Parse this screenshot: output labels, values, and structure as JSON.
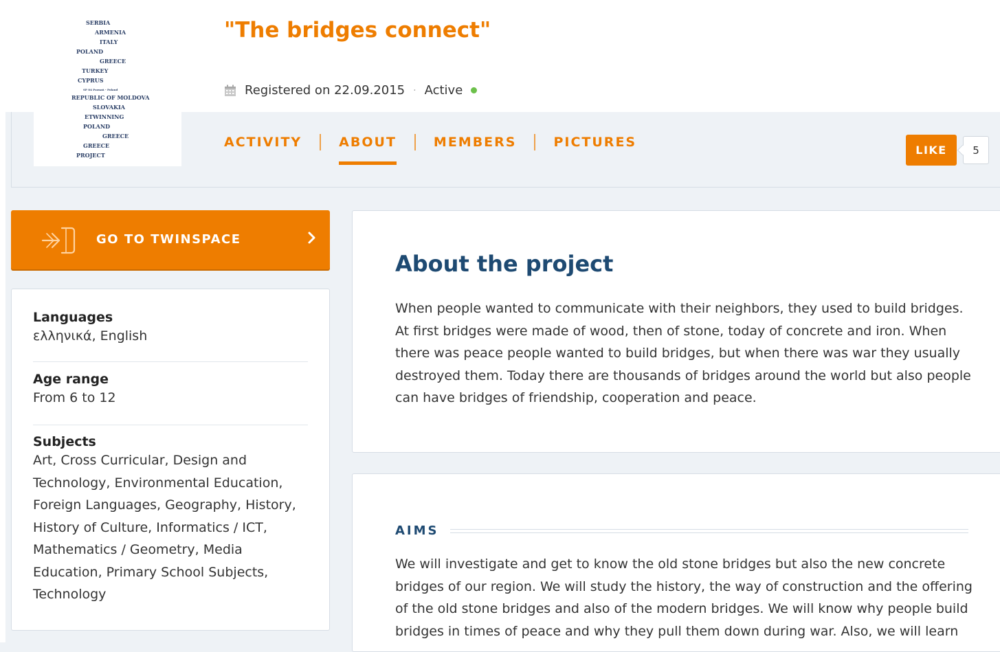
{
  "logo": {
    "words": [
      "SERBIA",
      "ARMENIA",
      "ITALY",
      "POLAND",
      "GREECE",
      "TURKEY",
      "CYPRUS",
      "SP 84 Poznań - Poland",
      "REPUBLIC OF MOLDOVA",
      "SLOVAKIA",
      "ETWINNING",
      "POLAND",
      "GREECE",
      "GREECE",
      "PROJECT"
    ]
  },
  "header": {
    "title": "\"The bridges connect\"",
    "registered": "Registered on 22.09.2015",
    "separator": "·",
    "status": "Active",
    "status_color": "#6cc04a"
  },
  "tabs": [
    {
      "label": "ACTIVITY",
      "active": false
    },
    {
      "label": "ABOUT",
      "active": true
    },
    {
      "label": "MEMBERS",
      "active": false
    },
    {
      "label": "PICTURES",
      "active": false
    }
  ],
  "like": {
    "label": "LIKE",
    "count": "5"
  },
  "twinspace": {
    "label": "GO TO TWINSPACE",
    "icon": "enter-icon"
  },
  "info": {
    "languages_label": "Languages",
    "languages_value": "ελληνικά, English",
    "age_label": "Age range",
    "age_value": "From 6 to 12",
    "subjects_label": "Subjects",
    "subjects_value": "Art, Cross Curricular, Design and Technology, Environmental Education, Foreign Languages, Geography, History, History of Culture, Informatics / ICT, Mathematics / Geometry, Media Education, Primary School Subjects, Technology"
  },
  "about": {
    "title": "About the project",
    "text": "When people wanted to communicate with their neighbors, they used to build bridges. At first bridges were made of wood, then of stone, today of concrete and iron. When there was peace people wanted to build bridges, but when there was war they usually destroyed them. Today there are thousands of bridges around the world but also people can have bridges of friendship, cooperation and peace."
  },
  "aims": {
    "label": "AIMS",
    "text": "We will investigate and get to know the old stone bridges but also the new concrete bridges of our region. We will study the history, the way of construction and the offering of the old stone bridges and also of the modern bridges. We will know why people build bridges in times of peace and why they pull them down during war. Also, we will learn"
  },
  "colors": {
    "accent": "#ee7d00",
    "heading": "#1e4a72",
    "background": "#eef2f6"
  }
}
